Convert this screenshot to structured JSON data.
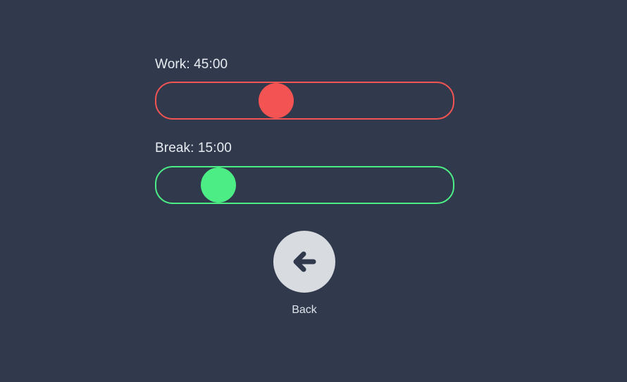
{
  "colors": {
    "background": "#303a4c",
    "work": "#f45353",
    "break": "#4ded86",
    "back_button_bg": "#d8dbe0",
    "back_icon": "#303a4c"
  },
  "work": {
    "label": "Work: 45:00",
    "fraction": 0.39
  },
  "break": {
    "label": "Break: 15:00",
    "fraction": 0.17
  },
  "back": {
    "icon": "arrow-left-icon",
    "label": "Back"
  }
}
